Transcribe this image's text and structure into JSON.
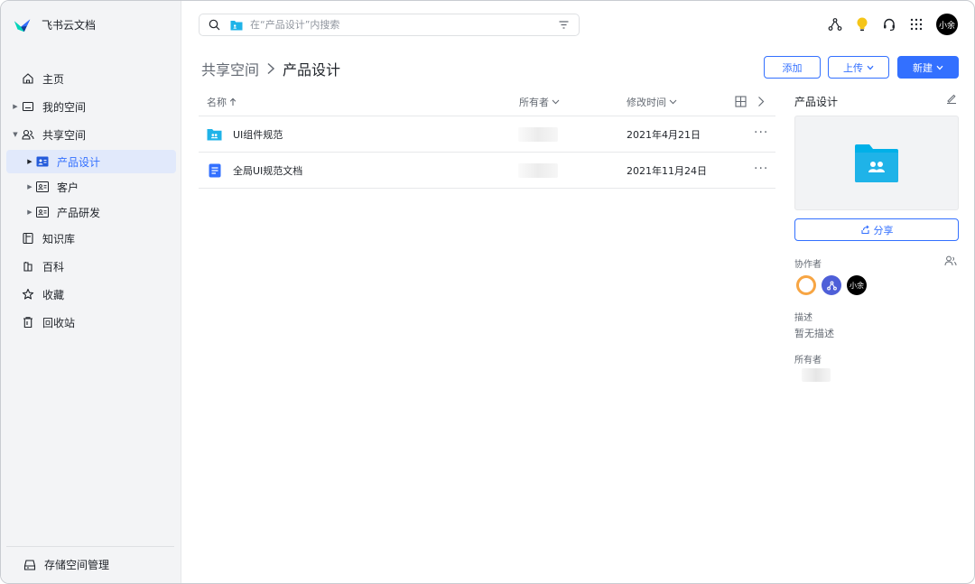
{
  "app": {
    "name": "飞书云文档"
  },
  "sidebar": {
    "items": [
      {
        "label": "主页",
        "icon": "home-icon"
      },
      {
        "label": "我的空间",
        "icon": "my-space-icon"
      },
      {
        "label": "共享空间",
        "icon": "shared-space-icon"
      },
      {
        "label": "产品设计",
        "icon": "team-folder-icon"
      },
      {
        "label": "客户",
        "icon": "team-folder-icon"
      },
      {
        "label": "产品研发",
        "icon": "team-folder-icon"
      },
      {
        "label": "知识库",
        "icon": "wiki-icon"
      },
      {
        "label": "百科",
        "icon": "encyclopedia-icon"
      },
      {
        "label": "收藏",
        "icon": "star-icon"
      },
      {
        "label": "回收站",
        "icon": "trash-icon"
      }
    ],
    "storage": "存储空间管理"
  },
  "search": {
    "placeholder": "在“产品设计”内搜索"
  },
  "topbar": {
    "avatar": "小余"
  },
  "breadcrumb": {
    "parent": "共享空间",
    "current": "产品设计"
  },
  "actions": {
    "add": "添加",
    "upload": "上传",
    "new": "新建"
  },
  "table": {
    "columns": {
      "name": "名称",
      "owner": "所有者",
      "modified": "修改时间"
    },
    "rows": [
      {
        "name": "UI组件规范",
        "date": "2021年4月21日",
        "icon": "shared-folder-icon"
      },
      {
        "name": "全局UI规范文档",
        "date": "2021年11月24日",
        "icon": "doc-icon"
      }
    ]
  },
  "panel": {
    "title": "产品设计",
    "share": "分享",
    "collaborators_label": "协作者",
    "collaborators": [
      {
        "label": ""
      },
      {
        "label": ""
      },
      {
        "label": "小余"
      }
    ],
    "description_label": "描述",
    "description": "暂无描述",
    "owner_label": "所有者"
  },
  "colors": {
    "accent": "#3370ff",
    "folder": "#1fb3e8",
    "sidebar_bg": "#f3f4f6",
    "active_bg": "#e1e9fb"
  }
}
